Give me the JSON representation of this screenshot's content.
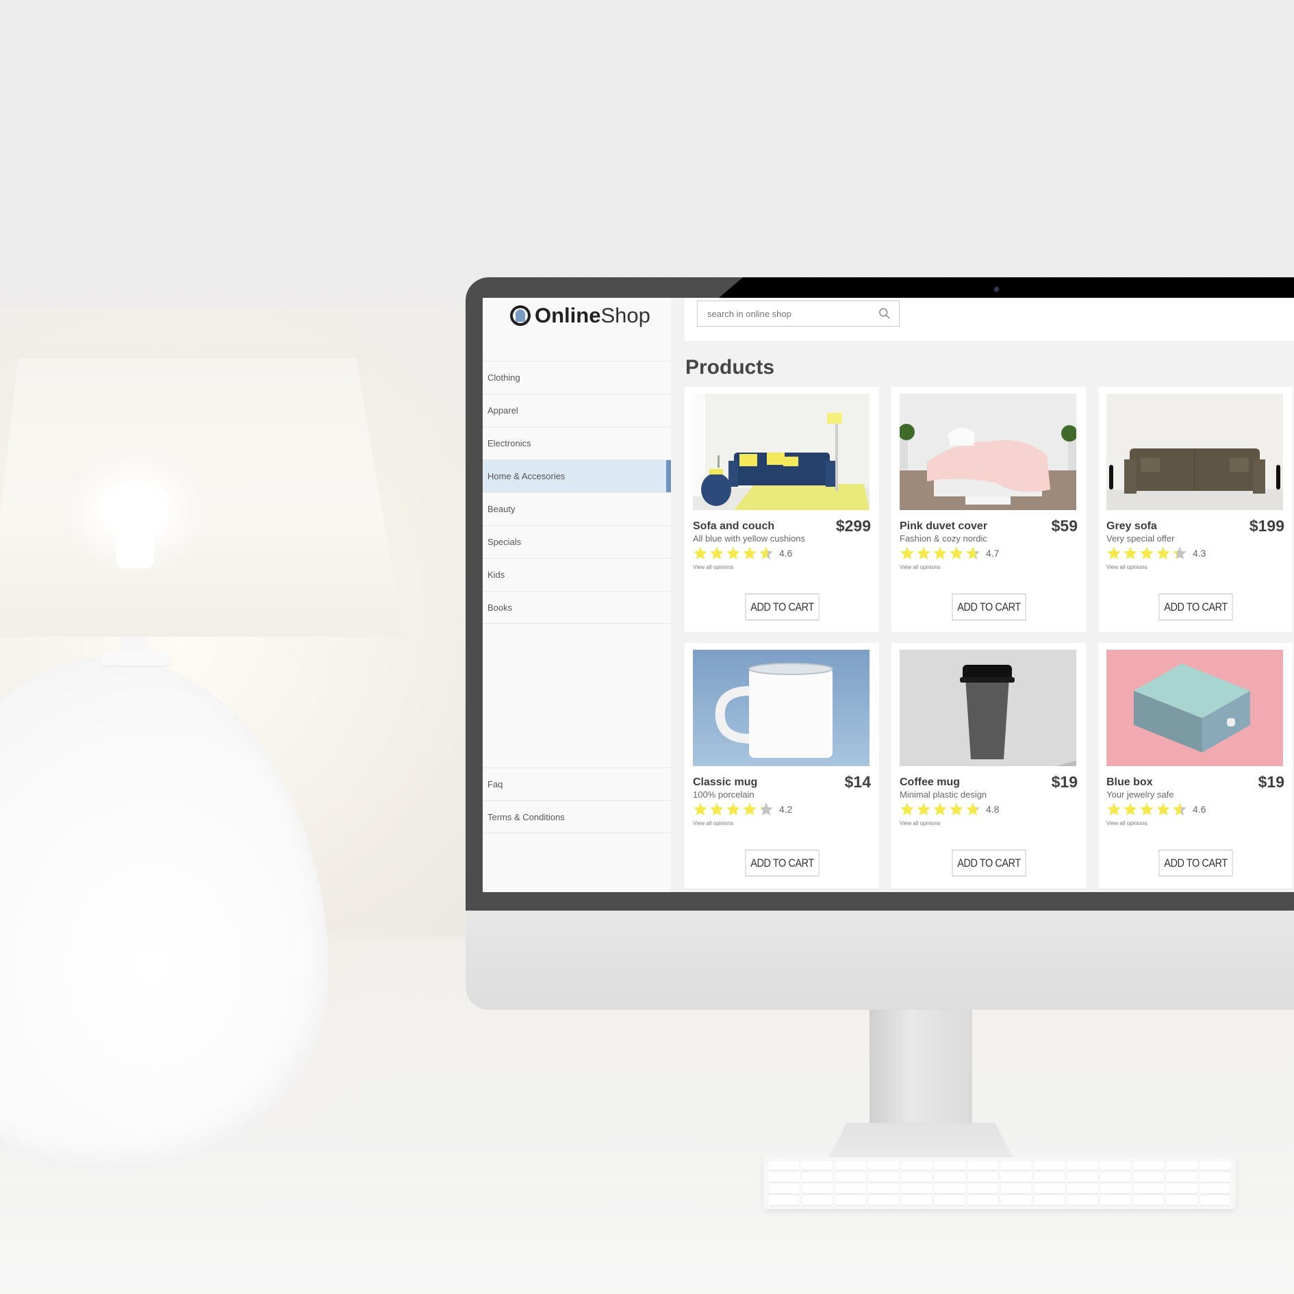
{
  "brand": {
    "name_bold": "Online",
    "name_light": "Shop",
    "accent_color": "#6f93bd"
  },
  "search": {
    "placeholder": "search in online shop",
    "value": ""
  },
  "sidebar": {
    "items": [
      {
        "label": "Clothing",
        "active": false
      },
      {
        "label": "Apparel",
        "active": false
      },
      {
        "label": "Electronics",
        "active": false
      },
      {
        "label": "Home & Accesories",
        "active": true
      },
      {
        "label": "Beauty",
        "active": false
      },
      {
        "label": "Specials",
        "active": false
      },
      {
        "label": "Kids",
        "active": false
      },
      {
        "label": "Books",
        "active": false
      }
    ],
    "footer_items": [
      {
        "label": "Faq"
      },
      {
        "label": "Terms & Conditions"
      }
    ]
  },
  "main": {
    "title": "Products",
    "products": [
      {
        "name": "Sofa and couch",
        "description": "All blue with yellow cushions",
        "price": "$299",
        "rating": "4.6",
        "rating_value": 4.6,
        "opinions_label": "View all opinions",
        "cart_label": "ADD TO CART",
        "image": "sofa-blue"
      },
      {
        "name": "Pink duvet cover",
        "description": "Fashion & cozy nordic",
        "price": "$59",
        "rating": "4.7",
        "rating_value": 4.7,
        "opinions_label": "View all opinions",
        "cart_label": "ADD TO CART",
        "image": "bed-pink"
      },
      {
        "name": "Grey sofa",
        "description": "Very special offer",
        "price": "$199",
        "rating": "4.3",
        "rating_value": 4.3,
        "opinions_label": "View all opinions",
        "cart_label": "ADD TO CART",
        "image": "sofa-grey"
      },
      {
        "name": "Classic mug",
        "description": "100% porcelain",
        "price": "$14",
        "rating": "4.2",
        "rating_value": 4.2,
        "opinions_label": "View all opinions",
        "cart_label": "ADD TO CART",
        "image": "mug-white"
      },
      {
        "name": "Coffee mug",
        "description": "Minimal plastic design",
        "price": "$19",
        "rating": "4.8",
        "rating_value": 4.8,
        "opinions_label": "View all opinions",
        "cart_label": "ADD TO CART",
        "image": "cup-coffee"
      },
      {
        "name": "Blue box",
        "description": "Your jewelry safe",
        "price": "$19",
        "rating": "4.6",
        "rating_value": 4.6,
        "opinions_label": "View all opinions",
        "cart_label": "ADD TO CART",
        "image": "box-blue"
      }
    ]
  },
  "colors": {
    "star_filled": "#f5e84a",
    "star_empty": "#c4c4c4",
    "active_nav_bg": "#dae9f3"
  }
}
